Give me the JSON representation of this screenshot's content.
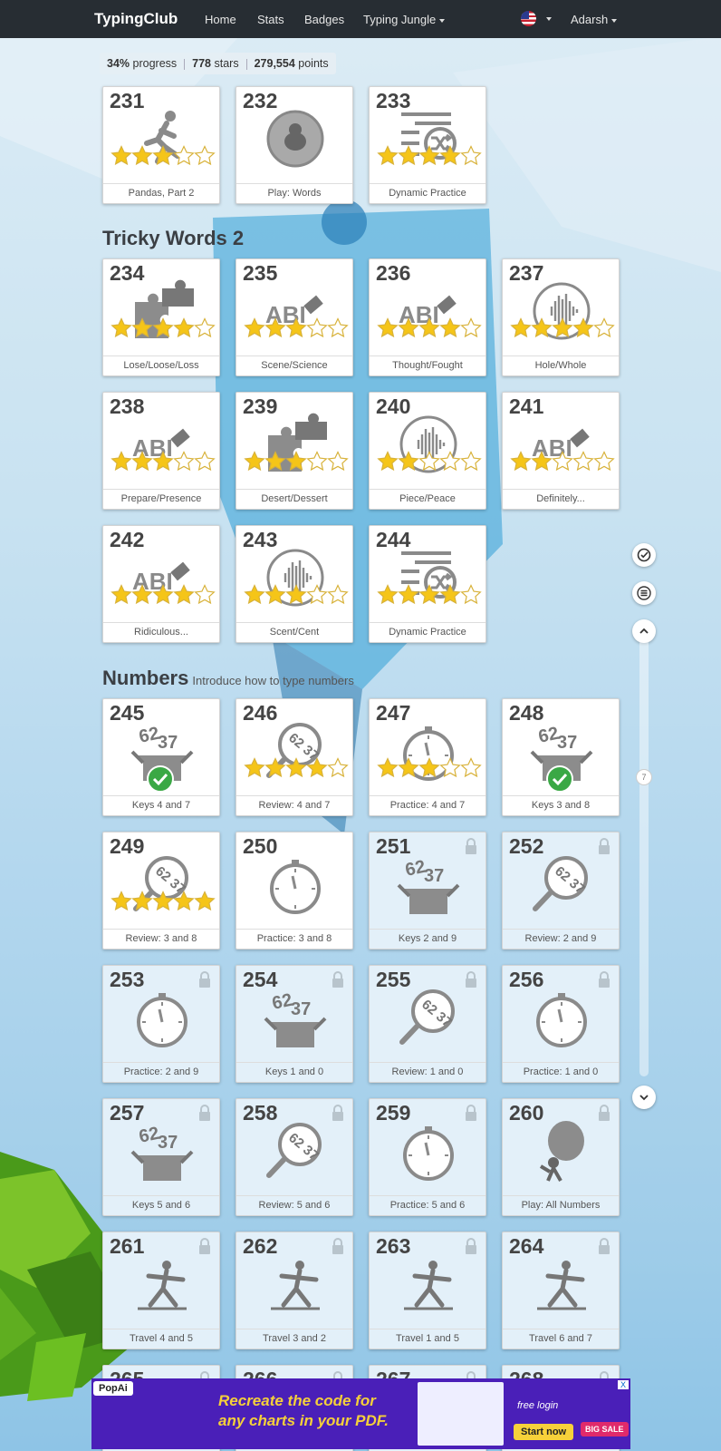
{
  "nav": {
    "brand": "TypingClub",
    "links": [
      "Home",
      "Stats",
      "Badges",
      "Typing Jungle"
    ],
    "user": "Adarsh"
  },
  "stats": {
    "progress": "34%",
    "progress_label": "progress",
    "stars": "778",
    "stars_label": "stars",
    "points": "279,554",
    "points_label": "points"
  },
  "sections": [
    {
      "title": "Tricky Words 2",
      "subtitle": ""
    },
    {
      "title": "Numbers",
      "subtitle": "Introduce how to type numbers"
    }
  ],
  "lessons": [
    {
      "num": "231",
      "label": "Pandas, Part 2",
      "icon": "runner-icon",
      "stars": 3,
      "locked": false
    },
    {
      "num": "232",
      "label": "Play: Words",
      "icon": "game-bubble-icon",
      "stars": 0,
      "locked": false
    },
    {
      "num": "233",
      "label": "Dynamic Practice",
      "icon": "shuffle-list-icon",
      "stars": 4,
      "locked": false
    },
    {
      "num": "234",
      "label": "Lose/Loose/Loss",
      "icon": "puzzle-icon",
      "stars": 4,
      "locked": false
    },
    {
      "num": "235",
      "label": "Scene/Science",
      "icon": "abc-eraser-icon",
      "stars": 3,
      "locked": false
    },
    {
      "num": "236",
      "label": "Thought/Fought",
      "icon": "abc-eraser-icon",
      "stars": 4,
      "locked": false
    },
    {
      "num": "237",
      "label": "Hole/Whole",
      "icon": "audio-wave-icon",
      "stars": 4,
      "locked": false
    },
    {
      "num": "238",
      "label": "Prepare/Presence",
      "icon": "abc-eraser-icon",
      "stars": 3,
      "locked": false
    },
    {
      "num": "239",
      "label": "Desert/Dessert",
      "icon": "puzzle-icon",
      "stars": 3,
      "locked": false
    },
    {
      "num": "240",
      "label": "Piece/Peace",
      "icon": "audio-wave-icon",
      "stars": 2,
      "locked": false
    },
    {
      "num": "241",
      "label": "Definitely...",
      "icon": "abc-eraser-icon",
      "stars": 2,
      "locked": false
    },
    {
      "num": "242",
      "label": "Ridiculous...",
      "icon": "abc-eraser-icon",
      "stars": 4,
      "locked": false
    },
    {
      "num": "243",
      "label": "Scent/Cent",
      "icon": "audio-wave-icon",
      "stars": 3,
      "locked": false
    },
    {
      "num": "244",
      "label": "Dynamic Practice",
      "icon": "shuffle-list-icon",
      "stars": 4,
      "locked": false
    },
    {
      "num": "245",
      "label": "Keys 4 and 7",
      "icon": "number-box-icon",
      "stars": 0,
      "check": true,
      "locked": false
    },
    {
      "num": "246",
      "label": "Review: 4 and 7",
      "icon": "magnifier-numbers-icon",
      "stars": 4,
      "locked": false
    },
    {
      "num": "247",
      "label": "Practice: 4 and 7",
      "icon": "stopwatch-icon",
      "stars": 3,
      "locked": false
    },
    {
      "num": "248",
      "label": "Keys 3 and 8",
      "icon": "number-box-icon",
      "stars": 0,
      "check": true,
      "locked": false
    },
    {
      "num": "249",
      "label": "Review: 3 and 8",
      "icon": "magnifier-numbers-icon",
      "stars": 5,
      "locked": false
    },
    {
      "num": "250",
      "label": "Practice: 3 and 8",
      "icon": "stopwatch-icon",
      "stars": 0,
      "locked": false
    },
    {
      "num": "251",
      "label": "Keys 2 and 9",
      "icon": "number-box-icon",
      "stars": 0,
      "locked": true
    },
    {
      "num": "252",
      "label": "Review: 2 and 9",
      "icon": "magnifier-numbers-icon",
      "stars": 0,
      "locked": true
    },
    {
      "num": "253",
      "label": "Practice: 2 and 9",
      "icon": "stopwatch-icon",
      "stars": 0,
      "locked": true
    },
    {
      "num": "254",
      "label": "Keys 1 and 0",
      "icon": "number-box-icon",
      "stars": 0,
      "locked": true
    },
    {
      "num": "255",
      "label": "Review: 1 and 0",
      "icon": "magnifier-numbers-icon",
      "stars": 0,
      "locked": true
    },
    {
      "num": "256",
      "label": "Practice: 1 and 0",
      "icon": "stopwatch-icon",
      "stars": 0,
      "locked": true
    },
    {
      "num": "257",
      "label": "Keys 5 and 6",
      "icon": "number-box-icon",
      "stars": 0,
      "locked": true
    },
    {
      "num": "258",
      "label": "Review: 5 and 6",
      "icon": "magnifier-numbers-icon",
      "stars": 0,
      "locked": true
    },
    {
      "num": "259",
      "label": "Practice: 5 and 6",
      "icon": "stopwatch-icon",
      "stars": 0,
      "locked": true
    },
    {
      "num": "260",
      "label": "Play: All Numbers",
      "icon": "balloon-game-icon",
      "stars": 0,
      "locked": true
    },
    {
      "num": "261",
      "label": "Travel 4 and 5",
      "icon": "yoga-pose-icon",
      "stars": 0,
      "locked": true
    },
    {
      "num": "262",
      "label": "Travel 3 and 2",
      "icon": "yoga-pose-icon",
      "stars": 0,
      "locked": true
    },
    {
      "num": "263",
      "label": "Travel 1 and 5",
      "icon": "yoga-pose-icon",
      "stars": 0,
      "locked": true
    },
    {
      "num": "264",
      "label": "Travel 6 and 7",
      "icon": "yoga-pose-icon",
      "stars": 0,
      "locked": true
    },
    {
      "num": "265",
      "label": "",
      "icon": "",
      "stars": 0,
      "locked": true
    },
    {
      "num": "266",
      "label": "",
      "icon": "",
      "stars": 0,
      "locked": true
    },
    {
      "num": "267",
      "label": "",
      "icon": "",
      "stars": 0,
      "locked": true
    },
    {
      "num": "268",
      "label": "",
      "icon": "",
      "stars": 0,
      "locked": true
    }
  ],
  "rail": {
    "page_indicator": "7"
  },
  "ad": {
    "brand": "PopAi",
    "headline_1": "Recreate the code for",
    "headline_2": "any charts in your PDF.",
    "free": "free login",
    "cta": "Start now",
    "sale": "BIG SALE",
    "close": "X"
  },
  "colors": {
    "navbar": "#272d33",
    "star": "#f5c518",
    "check": "#3aa845"
  }
}
